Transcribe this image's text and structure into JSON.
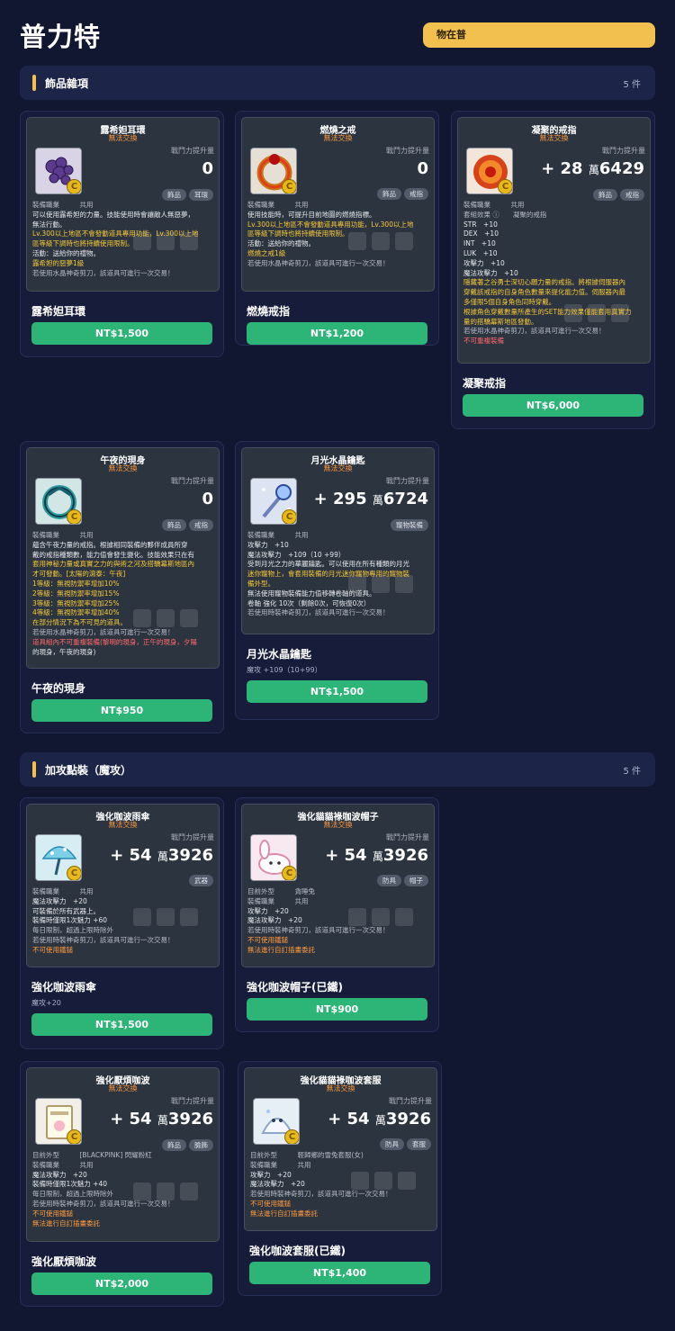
{
  "header": {
    "title": "普力特",
    "status": "物在普"
  },
  "sections": [
    {
      "title": "飾品雜項",
      "count": "5 件"
    },
    {
      "title": "加攻點裝（魔攻）",
      "count": "5 件"
    }
  ],
  "cards": [
    {
      "tooltip": {
        "name": "露希妲耳環",
        "notrade": "無法交換",
        "cmp_label": "戰鬥力提升量",
        "value": "0",
        "value_unit": "",
        "value_tail": "",
        "tags": [
          "飾品",
          "耳環"
        ],
        "lines": [
          {
            "t": "裝備職業　　　共用",
            "c": "g"
          },
          {
            "t": "可以使用露希妲的力量。技能使用時會讓敵人無惡夢，",
            "c": ""
          },
          {
            "t": "無法行動。",
            "c": ""
          },
          {
            "t": "Lv.300以上地區不會發動道具專用功能，Lv.300以上地",
            "c": "y"
          },
          {
            "t": "區等級下調時也將持續使用限制。",
            "c": "y"
          },
          {
            "t": "活動：送給你的禮物。",
            "c": ""
          },
          {
            "t": "露希妲的惡夢1級",
            "c": "y"
          },
          {
            "t": "若使用水晶神奇剪刀，該道具可進行一次交易！",
            "c": "g"
          }
        ]
      },
      "name": "露希妲耳環",
      "sub": "",
      "price": "NT$1,500",
      "icon": "earring-icon"
    },
    {
      "tooltip": {
        "name": "燃燒之戒",
        "notrade": "無法交換",
        "cmp_label": "戰鬥力提升量",
        "value": "0",
        "value_unit": "",
        "value_tail": "",
        "tags": [
          "飾品",
          "戒指"
        ],
        "lines": [
          {
            "t": "裝備職業　　　共用",
            "c": "g"
          },
          {
            "t": "使用技能時，可提升目前地圖的燃燒指標。",
            "c": ""
          },
          {
            "t": "Lv.300以上地區不會發動道具專用功能，Lv.300以上地",
            "c": "y"
          },
          {
            "t": "區等級下調時也將持續使用限制。",
            "c": "y"
          },
          {
            "t": "活動：送給你的禮物。",
            "c": ""
          },
          {
            "t": "燃燒之戒1級",
            "c": "y"
          },
          {
            "t": "若使用水晶神奇剪刀，該道具可進行一次交易！",
            "c": "g"
          }
        ]
      },
      "name": "燃燒戒指",
      "sub": "",
      "price": "NT$1,200",
      "icon": "ring-icon"
    },
    {
      "tooltip": {
        "name": "凝聚的戒指",
        "notrade": "無法交換",
        "cmp_label": "戰鬥力提升量",
        "value": "+ 28",
        "value_unit": "萬",
        "value_tail": "6429",
        "tags": [
          "飾品",
          "戒指"
        ],
        "lines": [
          {
            "t": "裝備職業　　　共用",
            "c": "g"
          },
          {
            "t": "套組效果 ⓘ　　凝聚的戒指",
            "c": "g"
          },
          {
            "t": "STR　+10",
            "c": ""
          },
          {
            "t": "DEX　+10",
            "c": ""
          },
          {
            "t": "INT　+10",
            "c": ""
          },
          {
            "t": "LUK　+10",
            "c": ""
          },
          {
            "t": "攻擊力　+10",
            "c": ""
          },
          {
            "t": "魔法攻擊力　+10",
            "c": ""
          },
          {
            "t": "隱藏著之谷勇士深切心願力量的戒指。將根據伺服器內",
            "c": "y"
          },
          {
            "t": "穿戴該戒指的自身角色數量來提化能力值。伺服器內最",
            "c": "y"
          },
          {
            "t": "多僅限5個自身角色同時穿戴。",
            "c": "y"
          },
          {
            "t": "根據角色穿戴數量所產生的SET能力效果僅能套用真實力",
            "c": "y"
          },
          {
            "t": "量的搭驕幕斯地區發動。",
            "c": "y"
          },
          {
            "t": "若使用水晶神奇剪刀，該道具可進行一次交易！",
            "c": "g"
          },
          {
            "t": "不可重複裝備",
            "c": "r"
          }
        ]
      },
      "name": "凝聚戒指",
      "sub": "",
      "price": "NT$6,000",
      "icon": "ruby-ring-icon"
    },
    {
      "tooltip": {
        "name": "午夜的現身",
        "notrade": "無法交換",
        "cmp_label": "戰鬥力提升量",
        "value": "0",
        "value_unit": "",
        "value_tail": "",
        "tags": [
          "飾品",
          "戒指"
        ],
        "lines": [
          {
            "t": "裝備職業　　　共用",
            "c": "g"
          },
          {
            "t": "蘊含午夜力量的戒指。根據相同裝備的夥伴成員所穿",
            "c": ""
          },
          {
            "t": "戴的戒指種類數，能力值會發生變化。技能效果只在有",
            "c": ""
          },
          {
            "t": "套用神秘力量或真實之力的與術之河及搭驕幕斯地區內",
            "c": "y"
          },
          {
            "t": "才可發動。[太陽的瀉泰：午夜]",
            "c": "y"
          },
          {
            "t": "1等級：無視防禦率增加10%",
            "c": "y"
          },
          {
            "t": "2等級：無視防禦率增加15%",
            "c": "y"
          },
          {
            "t": "3等級：無視防禦率增加25%",
            "c": "y"
          },
          {
            "t": "4等級：無視防禦率增加40%",
            "c": "y"
          },
          {
            "t": "在部分情況下為不可見的道具。",
            "c": "y"
          },
          {
            "t": "若使用水晶神奇剪刀，該道具可進行一次交易！",
            "c": "g"
          },
          {
            "t": "道具組內不可重複裝備(黎明的現身，正午的現身，夕陽",
            "c": "r"
          },
          {
            "t": "的現身，午夜的現身)",
            "c": ""
          }
        ]
      },
      "name": "午夜的現身",
      "sub": "",
      "price": "NT$950",
      "icon": "midnight-ring-icon"
    },
    {
      "tooltip": {
        "name": "月光水晶鑰匙",
        "notrade": "無法交換",
        "cmp_label": "戰鬥力提升量",
        "value": "+ 295",
        "value_unit": "萬",
        "value_tail": "6724",
        "tags": [
          "寵物裝備"
        ],
        "lines": [
          {
            "t": "裝備職業　　　共用",
            "c": "g"
          },
          {
            "t": "攻擊力　+10",
            "c": ""
          },
          {
            "t": "魔法攻擊力　+109（10 +99）",
            "c": ""
          },
          {
            "t": "受到月光之力的華麗鑰匙。可以使用在所有種類的月光",
            "c": ""
          },
          {
            "t": "迷你寵物上，會套用裝備的月光迷你寵物專用的寵物裝",
            "c": "y"
          },
          {
            "t": "備外型。",
            "c": "y"
          },
          {
            "t": "無法使用寵物裝備能力值移轉卷軸的道具。",
            "c": ""
          },
          {
            "t": "卷軸 強化 10次（剩餘0次，可恢復0次）",
            "c": ""
          },
          {
            "t": "若使用時裝神奇剪刀，該道具可進行一次交易！",
            "c": "g"
          }
        ]
      },
      "name": "月光水晶鑰匙",
      "sub": "魔攻 +109（10+99）",
      "price": "NT$1,500",
      "icon": "wand-icon"
    },
    {
      "tooltip": {
        "name": "強化咖波雨傘",
        "notrade": "無法交換",
        "cmp_label": "戰鬥力提升量",
        "value": "+ 54",
        "value_unit": "萬",
        "value_tail": "3926",
        "tags": [
          "武器"
        ],
        "lines": [
          {
            "t": "裝備職業　　　共用",
            "c": "g"
          },
          {
            "t": "魔法攻擊力　+20",
            "c": ""
          },
          {
            "t": "可裝備於所有武器上。",
            "c": ""
          },
          {
            "t": "裝備時僅限1次魅力 +60",
            "c": ""
          },
          {
            "t": "每日限制，超過上限時除外",
            "c": "g"
          },
          {
            "t": "若使用時裝神奇剪刀，該道具可進行一次交易！",
            "c": "g"
          },
          {
            "t": "不可使用鐵鎚",
            "c": "o"
          }
        ]
      },
      "name": "強化咖波雨傘",
      "sub": "魔攻+20",
      "price": "NT$1,500",
      "icon": "umbrella-icon"
    },
    {
      "tooltip": {
        "name": "強化貓貓祿咖波帽子",
        "notrade": "無法交換",
        "cmp_label": "戰鬥力提升量",
        "value": "+ 54",
        "value_unit": "萬",
        "value_tail": "3926",
        "tags": [
          "防具",
          "帽子"
        ],
        "lines": [
          {
            "t": "目前外型　　　貪睡兔",
            "c": "g"
          },
          {
            "t": "裝備職業　　　共用",
            "c": "g"
          },
          {
            "t": "攻擊力　+20",
            "c": ""
          },
          {
            "t": "魔法攻擊力　+20",
            "c": ""
          },
          {
            "t": "若使用時裝神奇剪刀，該道具可進行一次交易！",
            "c": "g"
          },
          {
            "t": "不可使用鐵鎚",
            "c": "o"
          },
          {
            "t": "無法進行自訂插畫委託",
            "c": "o"
          }
        ]
      },
      "name": "強化咖波帽子(已鐵)",
      "sub": "",
      "price": "NT$900",
      "icon": "bunny-hat-icon"
    },
    {
      "tooltip": {
        "name": "強化厭煩咖波",
        "notrade": "無法交換",
        "cmp_label": "戰鬥力提升量",
        "value": "+ 54",
        "value_unit": "萬",
        "value_tail": "3926",
        "tags": [
          "飾品",
          "臉飾"
        ],
        "lines": [
          {
            "t": "目前外型　　　[BLACKPINK] 閃耀粉紅",
            "c": "g"
          },
          {
            "t": "裝備職業　　　共用",
            "c": "g"
          },
          {
            "t": "魔法攻擊力　+20",
            "c": ""
          },
          {
            "t": "裝備時僅限1次魅力 +40",
            "c": ""
          },
          {
            "t": "每日限制，超過上限時除外",
            "c": "g"
          },
          {
            "t": "若使用時裝神奇剪刀，該道具可進行一次交易！",
            "c": "g"
          },
          {
            "t": "不可使用鐵鎚",
            "c": "o"
          },
          {
            "t": "無法進行自訂插畫委託",
            "c": "o"
          }
        ]
      },
      "name": "強化厭煩咖波",
      "sub": "",
      "price": "NT$2,000",
      "icon": "face-accessory-icon"
    },
    {
      "tooltip": {
        "name": "強化貓貓祿咖波套服",
        "notrade": "無法交換",
        "cmp_label": "戰鬥力提升量",
        "value": "+ 54",
        "value_unit": "萬",
        "value_tail": "3926",
        "tags": [
          "防具",
          "套服"
        ],
        "lines": [
          {
            "t": "目前外型　　　輕歸鄉的雪兔套服(女)",
            "c": "g"
          },
          {
            "t": "裝備職業　　　共用",
            "c": "g"
          },
          {
            "t": "攻擊力　+20",
            "c": ""
          },
          {
            "t": "魔法攻擊力　+20",
            "c": ""
          },
          {
            "t": "若使用時裝神奇剪刀，該道具可進行一次交易！",
            "c": "g"
          },
          {
            "t": "不可使用鐵鎚",
            "c": "o"
          },
          {
            "t": "無法進行自訂插畫委託",
            "c": "o"
          }
        ]
      },
      "name": "強化咖波套服(已鐵)",
      "sub": "",
      "price": "NT$1,400",
      "icon": "snow-outfit-icon"
    }
  ],
  "colors": {
    "accent": "#f2c04e",
    "buy": "#2db578",
    "bg": "#111631",
    "panel": "#1c2448"
  }
}
